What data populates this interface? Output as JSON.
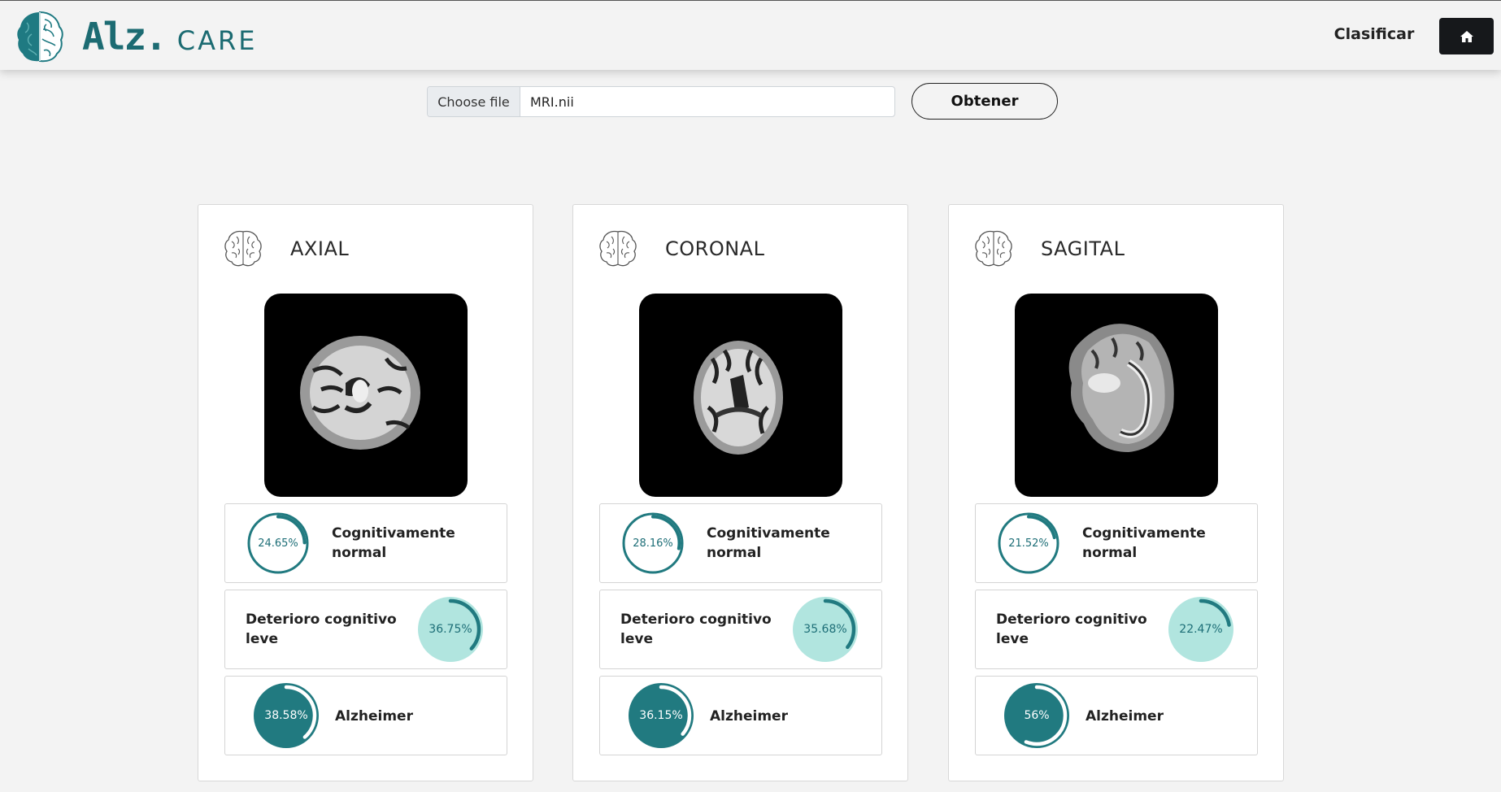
{
  "brand": {
    "alz": "Alz.",
    "care": "CARE"
  },
  "nav": {
    "clasificar": "Clasificar"
  },
  "upload": {
    "choose_label": "Choose file",
    "file_name": "MRI.nii",
    "submit_label": "Obtener"
  },
  "colors": {
    "accent": "#1f7a82",
    "dark_fill": "#217a80",
    "light_fill": "#b1e5df",
    "ring_stroke": "#217a80"
  },
  "icons": {
    "home": "home-icon",
    "brain": "brain-icon",
    "logo": "brain-logo"
  },
  "cards": [
    {
      "title": "AXIAL",
      "results": [
        {
          "label_line1": "Cognitivamente",
          "label_line2": "normal",
          "percent": "24.65%",
          "value": 24.65
        },
        {
          "label_line1": "Deterioro cognitivo",
          "label_line2": "leve",
          "percent": "36.75%",
          "value": 36.75
        },
        {
          "label_line1": "Alzheimer",
          "label_line2": "",
          "percent": "38.58%",
          "value": 38.58
        }
      ]
    },
    {
      "title": "CORONAL",
      "results": [
        {
          "label_line1": "Cognitivamente",
          "label_line2": "normal",
          "percent": "28.16%",
          "value": 28.16
        },
        {
          "label_line1": "Deterioro cognitivo",
          "label_line2": "leve",
          "percent": "35.68%",
          "value": 35.68
        },
        {
          "label_line1": "Alzheimer",
          "label_line2": "",
          "percent": "36.15%",
          "value": 36.15
        }
      ]
    },
    {
      "title": "SAGITAL",
      "results": [
        {
          "label_line1": "Cognitivamente",
          "label_line2": "normal",
          "percent": "21.52%",
          "value": 21.52
        },
        {
          "label_line1": "Deterioro cognitivo",
          "label_line2": "leve",
          "percent": "22.47%",
          "value": 22.47
        },
        {
          "label_line1": "Alzheimer",
          "label_line2": "",
          "percent": "56%",
          "value": 56
        }
      ]
    }
  ]
}
